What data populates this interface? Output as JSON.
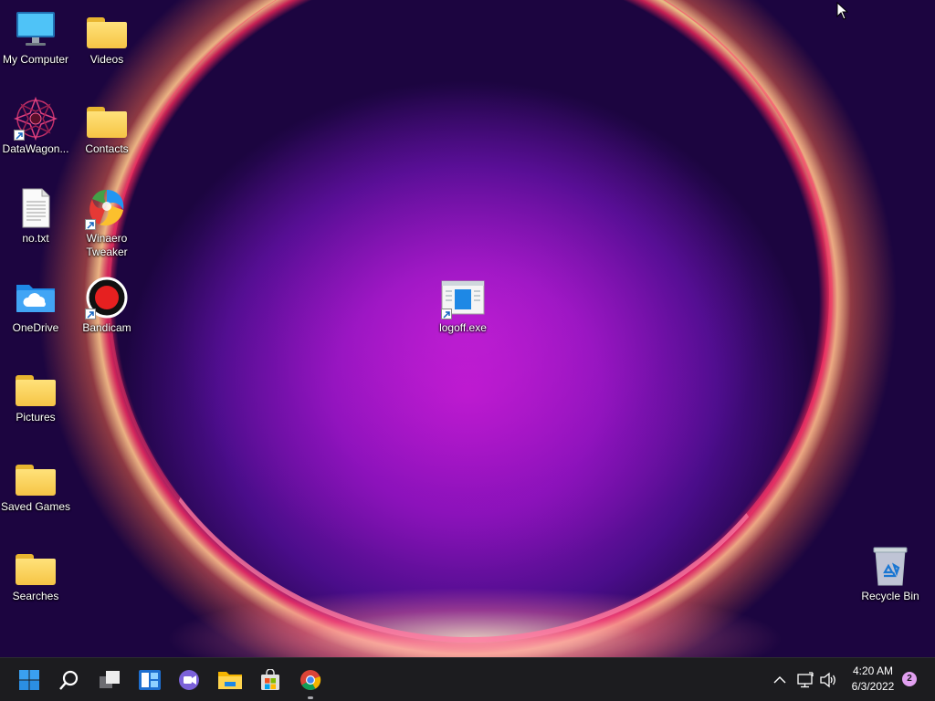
{
  "desktop": {
    "icons": [
      {
        "label": "My Computer",
        "icon": "computer-monitor-icon"
      },
      {
        "label": "Videos",
        "icon": "folder-icon"
      },
      {
        "label": "DataWagon...",
        "icon": "datawagon-mandala-icon",
        "shortcut": true
      },
      {
        "label": "Contacts",
        "icon": "folder-icon"
      },
      {
        "label": "no.txt",
        "icon": "text-document-icon"
      },
      {
        "label": "Winaero Tweaker",
        "icon": "winaero-tweaker-icon",
        "shortcut": true
      },
      {
        "label": "OneDrive",
        "icon": "onedrive-folder-icon"
      },
      {
        "label": "Bandicam",
        "icon": "bandicam-record-icon",
        "shortcut": true
      },
      {
        "label": "Pictures",
        "icon": "folder-icon"
      },
      {
        "label": "Saved Games",
        "icon": "folder-icon"
      },
      {
        "label": "Searches",
        "icon": "folder-icon"
      },
      {
        "label": "logoff.exe",
        "icon": "exe-window-icon",
        "shortcut": true
      },
      {
        "label": "Recycle Bin",
        "icon": "recycle-bin-icon"
      }
    ]
  },
  "taskbar": {
    "buttons": [
      {
        "name": "start",
        "icon": "windows-start-icon"
      },
      {
        "name": "search",
        "icon": "search-icon"
      },
      {
        "name": "task-view",
        "icon": "task-view-icon"
      },
      {
        "name": "widgets",
        "icon": "widgets-icon"
      },
      {
        "name": "chat",
        "icon": "teams-chat-icon"
      },
      {
        "name": "file-explorer",
        "icon": "file-explorer-icon"
      },
      {
        "name": "store",
        "icon": "microsoft-store-icon"
      },
      {
        "name": "chrome",
        "icon": "chrome-icon",
        "running": true
      }
    ],
    "tray": {
      "overflow_icon": "chevron-up-icon",
      "network_icon": "network-icon",
      "volume_icon": "volume-icon",
      "time": "4:20 AM",
      "date": "6/3/2022",
      "notification_count": "2"
    }
  },
  "colors": {
    "taskbar_bg": "#1c1c1f",
    "folder_yellow": "#f6c445",
    "accent_blue": "#0a84d8",
    "notification_badge": "#e1a0f0"
  }
}
